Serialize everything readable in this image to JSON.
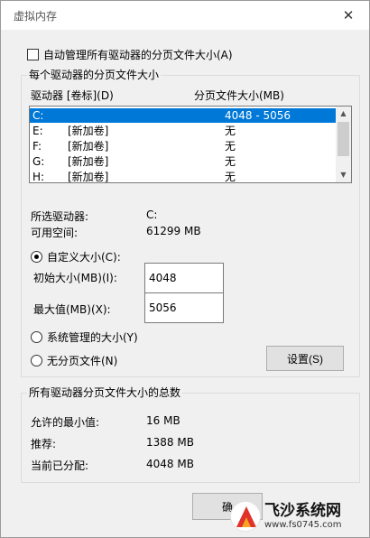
{
  "window": {
    "title": "虚拟内存",
    "close_glyph": "✕"
  },
  "auto_manage": {
    "label": "自动管理所有驱动器的分页文件大小(A)",
    "checked": false
  },
  "drives_group": {
    "title": "每个驱动器的分页文件大小",
    "col_drive": "驱动器 [卷标](D)",
    "col_size": "分页文件大小(MB)",
    "rows": [
      {
        "drive": "C:",
        "label": "",
        "size": "4048 - 5056",
        "selected": true
      },
      {
        "drive": "E:",
        "label": "[新加卷]",
        "size": "无",
        "selected": false
      },
      {
        "drive": "F:",
        "label": "[新加卷]",
        "size": "无",
        "selected": false
      },
      {
        "drive": "G:",
        "label": "[新加卷]",
        "size": "无",
        "selected": false
      },
      {
        "drive": "H:",
        "label": "[新加卷]",
        "size": "无",
        "selected": false
      }
    ],
    "selected_drive_label": "所选驱动器:",
    "selected_drive_value": "C:",
    "free_space_label": "可用空间:",
    "free_space_value": "61299 MB",
    "custom_size_label": "自定义大小(C):",
    "initial_label": "初始大小(MB)(I):",
    "initial_value": "4048",
    "max_label": "最大值(MB)(X):",
    "max_value": "5056",
    "system_managed_label": "系统管理的大小(Y)",
    "no_paging_label": "无分页文件(N)",
    "set_button": "设置(S)",
    "selected_option": "custom"
  },
  "totals_group": {
    "title": "所有驱动器分页文件大小的总数",
    "min_label": "允许的最小值:",
    "min_value": "16 MB",
    "recommended_label": "推荐:",
    "recommended_value": "1388 MB",
    "current_label": "当前已分配:",
    "current_value": "4048 MB"
  },
  "ok_button": "确",
  "watermark": {
    "title": "飞沙系统网",
    "url": "www.fs0745.com"
  },
  "colors": {
    "selection": "#0078d7",
    "dialog_bg": "#f0f0f0",
    "logo_red": "#e0312a",
    "logo_orange": "#f6a623"
  }
}
